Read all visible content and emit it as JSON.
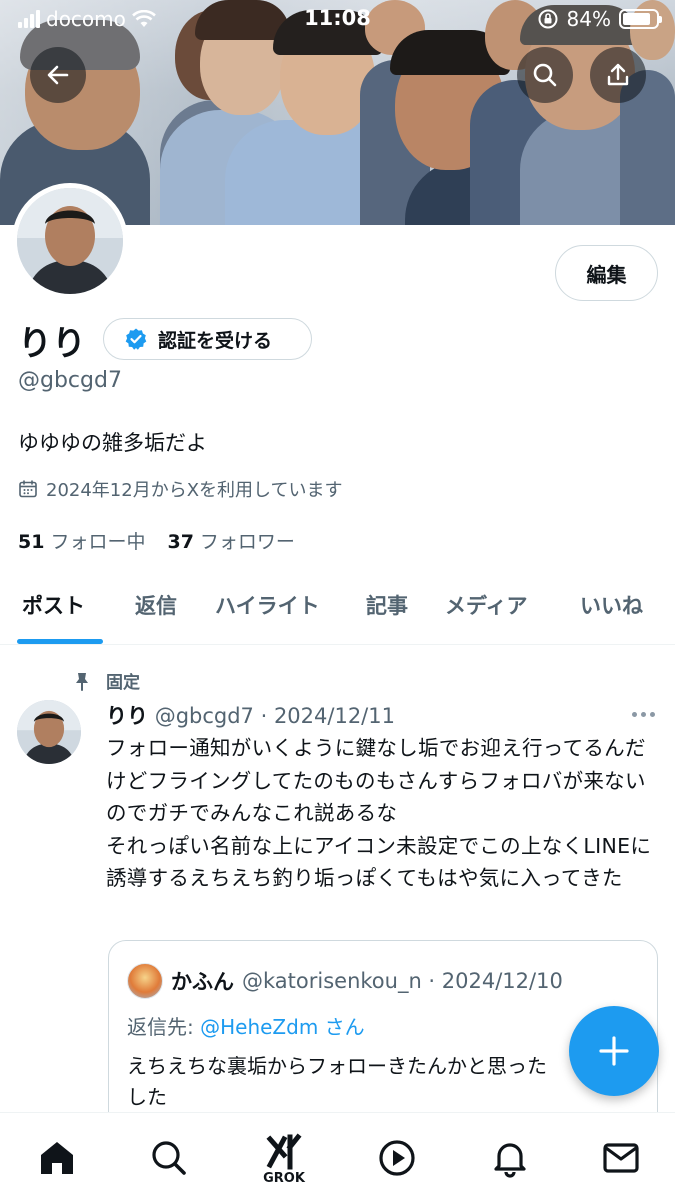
{
  "status_bar": {
    "carrier": "docomo",
    "time": "11:08",
    "battery": "84%",
    "battery_level": 0.84
  },
  "header": {
    "back_icon": "arrow-left-icon",
    "search_icon": "search-icon",
    "share_icon": "share-icon"
  },
  "profile": {
    "name": "りり",
    "verify_label": "認証を受ける",
    "handle": "@gbcgd7",
    "edit_label": "編集",
    "bio": "ゆゆゆの雑多垢だよ",
    "joined": "2024年12月からXを利用しています",
    "following_count": "51",
    "following_label": "フォロー中",
    "followers_count": "37",
    "followers_label": "フォロワー"
  },
  "tabs": [
    {
      "label": "ポスト"
    },
    {
      "label": "返信"
    },
    {
      "label": "ハイライト"
    },
    {
      "label": "記事"
    },
    {
      "label": "メディア"
    },
    {
      "label": "いいね"
    }
  ],
  "post": {
    "pinned_label": "固定",
    "author_name": "りり",
    "author_meta": "@gbcgd7 · 2024/12/11",
    "text": "フォロー通知がいくように鍵なし垢でお迎え行ってるんだけどフライングしてたのものもさんすらフォロバが来ないのでガチでみんなこれ説あるな\nそれっぽい名前な上にアイコン未設定でこの上なくLINEに誘導するえちえち釣り垢っぽくてもはや気に入ってきた",
    "quote": {
      "author_name": "かふん",
      "author_meta": "@katorisenkou_n · 2024/12/10",
      "reply_prefix": "返信先: ",
      "reply_to": "@HeheZdm さん",
      "text": "えちえちな裏垢からフォローきたんかと思った\nした"
    }
  },
  "bottom_nav": {
    "grok_label": "GROK"
  },
  "colors": {
    "accent": "#1d9bf0",
    "text": "#0f1419",
    "muted": "#536471"
  }
}
